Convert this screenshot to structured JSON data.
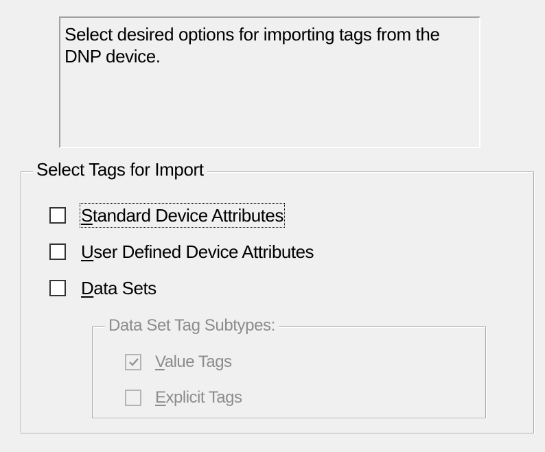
{
  "description": {
    "line1": "Select desired options for importing tags from the",
    "line2": "DNP device."
  },
  "select_tags_group": {
    "title": "Select Tags for Import",
    "options": [
      {
        "label_first": "S",
        "label_rest": "tandard Device Attributes",
        "checked": false,
        "focused": true
      },
      {
        "label_first": "U",
        "label_rest": "ser Defined Device Attributes",
        "checked": false
      },
      {
        "label_first": "D",
        "label_rest": "ata Sets",
        "checked": false
      }
    ]
  },
  "subtypes_group": {
    "title": "Data Set Tag Subtypes:",
    "enabled": false,
    "options": [
      {
        "label_first": "V",
        "label_rest": "alue Tags",
        "checked": true
      },
      {
        "label_first": "E",
        "label_rest": "xplicit Tags",
        "checked": false
      }
    ]
  }
}
